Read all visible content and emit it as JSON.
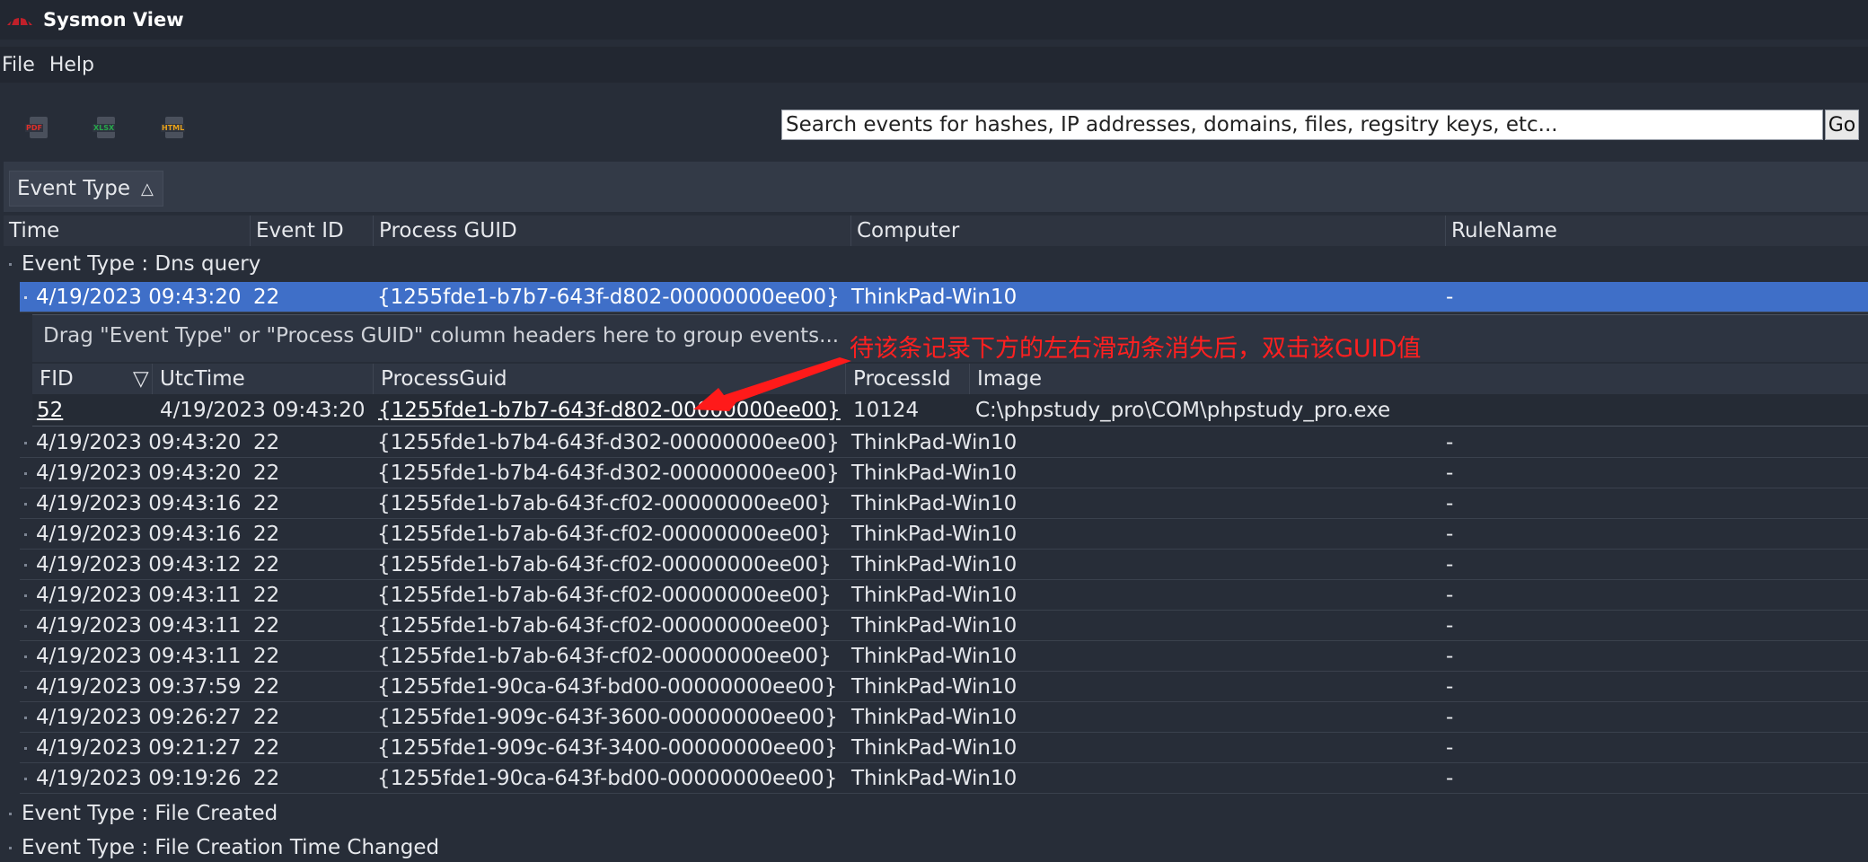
{
  "app": {
    "title": "Sysmon View"
  },
  "menu": [
    "File",
    "Help"
  ],
  "toolbar": {
    "exports": [
      {
        "label": "PDF",
        "color": "#e0302a",
        "icon": "pdf-icon"
      },
      {
        "label": "XLSX",
        "color": "#27a84a",
        "icon": "xlsx-icon"
      },
      {
        "label": "HTML",
        "color": "#e8a21a",
        "icon": "html-icon"
      }
    ],
    "search_placeholder": "Search events for hashes, IP addresses, domains, files, regsitry keys, etc...",
    "go_label": "Go"
  },
  "group_panel": {
    "chip_label": "Event Type",
    "sort_glyph": "△"
  },
  "columns": [
    "Time",
    "Event ID",
    "Process GUID",
    "Computer",
    "RuleName"
  ],
  "groups": [
    "Event Type : Dns query",
    "Event Type : File Created",
    "Event Type : File Creation Time Changed"
  ],
  "rows": [
    {
      "time": "4/19/2023 09:43:20",
      "id": "22",
      "guid": "{1255fde1-b7b7-643f-d802-00000000ee00}",
      "computer": "ThinkPad-Win10",
      "rule": "-"
    },
    {
      "time": "4/19/2023 09:43:20",
      "id": "22",
      "guid": "{1255fde1-b7b4-643f-d302-00000000ee00}",
      "computer": "ThinkPad-Win10",
      "rule": "-"
    },
    {
      "time": "4/19/2023 09:43:20",
      "id": "22",
      "guid": "{1255fde1-b7b4-643f-d302-00000000ee00}",
      "computer": "ThinkPad-Win10",
      "rule": "-"
    },
    {
      "time": "4/19/2023 09:43:16",
      "id": "22",
      "guid": "{1255fde1-b7ab-643f-cf02-00000000ee00}",
      "computer": "ThinkPad-Win10",
      "rule": "-"
    },
    {
      "time": "4/19/2023 09:43:16",
      "id": "22",
      "guid": "{1255fde1-b7ab-643f-cf02-00000000ee00}",
      "computer": "ThinkPad-Win10",
      "rule": "-"
    },
    {
      "time": "4/19/2023 09:43:12",
      "id": "22",
      "guid": "{1255fde1-b7ab-643f-cf02-00000000ee00}",
      "computer": "ThinkPad-Win10",
      "rule": "-"
    },
    {
      "time": "4/19/2023 09:43:11",
      "id": "22",
      "guid": "{1255fde1-b7ab-643f-cf02-00000000ee00}",
      "computer": "ThinkPad-Win10",
      "rule": "-"
    },
    {
      "time": "4/19/2023 09:43:11",
      "id": "22",
      "guid": "{1255fde1-b7ab-643f-cf02-00000000ee00}",
      "computer": "ThinkPad-Win10",
      "rule": "-"
    },
    {
      "time": "4/19/2023 09:43:11",
      "id": "22",
      "guid": "{1255fde1-b7ab-643f-cf02-00000000ee00}",
      "computer": "ThinkPad-Win10",
      "rule": "-"
    },
    {
      "time": "4/19/2023 09:37:59",
      "id": "22",
      "guid": "{1255fde1-90ca-643f-bd00-00000000ee00}",
      "computer": "ThinkPad-Win10",
      "rule": "-"
    },
    {
      "time": "4/19/2023 09:26:27",
      "id": "22",
      "guid": "{1255fde1-909c-643f-3600-00000000ee00}",
      "computer": "ThinkPad-Win10",
      "rule": "-"
    },
    {
      "time": "4/19/2023 09:21:27",
      "id": "22",
      "guid": "{1255fde1-909c-643f-3400-00000000ee00}",
      "computer": "ThinkPad-Win10",
      "rule": "-"
    },
    {
      "time": "4/19/2023 09:19:26",
      "id": "22",
      "guid": "{1255fde1-90ca-643f-bd00-00000000ee00}",
      "computer": "ThinkPad-Win10",
      "rule": "-"
    }
  ],
  "detail": {
    "drag_hint": "Drag \"Event Type\" or \"Process GUID\" column headers here to group events...",
    "columns": [
      "FID",
      "UtcTime",
      "ProcessGuid",
      "ProcessId",
      "Image"
    ],
    "sort_glyph": "▽",
    "row": {
      "fid": "52",
      "utc": "4/19/2023 09:43:20",
      "guid": "{1255fde1-b7b7-643f-d802-00000000ee00}",
      "pid": "10124",
      "image": "C:\\phpstudy_pro\\COM\\phpstudy_pro.exe"
    }
  },
  "annotation": "待该条记录下方的左右滑动条消失后，双击该GUID值"
}
